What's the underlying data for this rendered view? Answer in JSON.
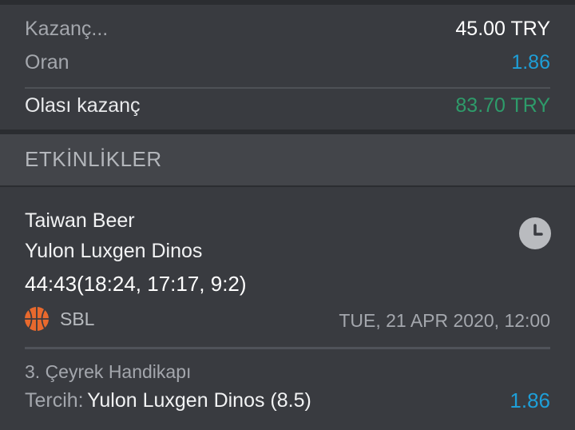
{
  "summary": {
    "stake_label": "Kazanç...",
    "stake_value": "45.00 TRY",
    "odds_label": "Oran",
    "odds_value": "1.86",
    "potential_label": "Olası kazanç",
    "potential_value": "83.70 TRY"
  },
  "events_header": "ETKİNLİKLER",
  "event": {
    "home_team": "Taiwan Beer",
    "away_team": "Yulon Luxgen Dinos",
    "score": "44:43(18:24, 17:17, 9:2)",
    "league_icon": "basketball-icon",
    "league": "SBL",
    "datetime": "TUE, 21 APR 2020, 12:00",
    "status_icon": "clock-icon",
    "market": "3. Çeyrek Handikapı",
    "pick_label": "Tercih:",
    "pick_value": "Yulon Luxgen Dinos (8.5)",
    "pick_odds": "1.86"
  },
  "colors": {
    "odds_blue": "#1e9fd8",
    "win_green": "#2e9b6a",
    "basketball_orange": "#e8692d",
    "background": "#393b40",
    "header_bg": "#43454a"
  }
}
